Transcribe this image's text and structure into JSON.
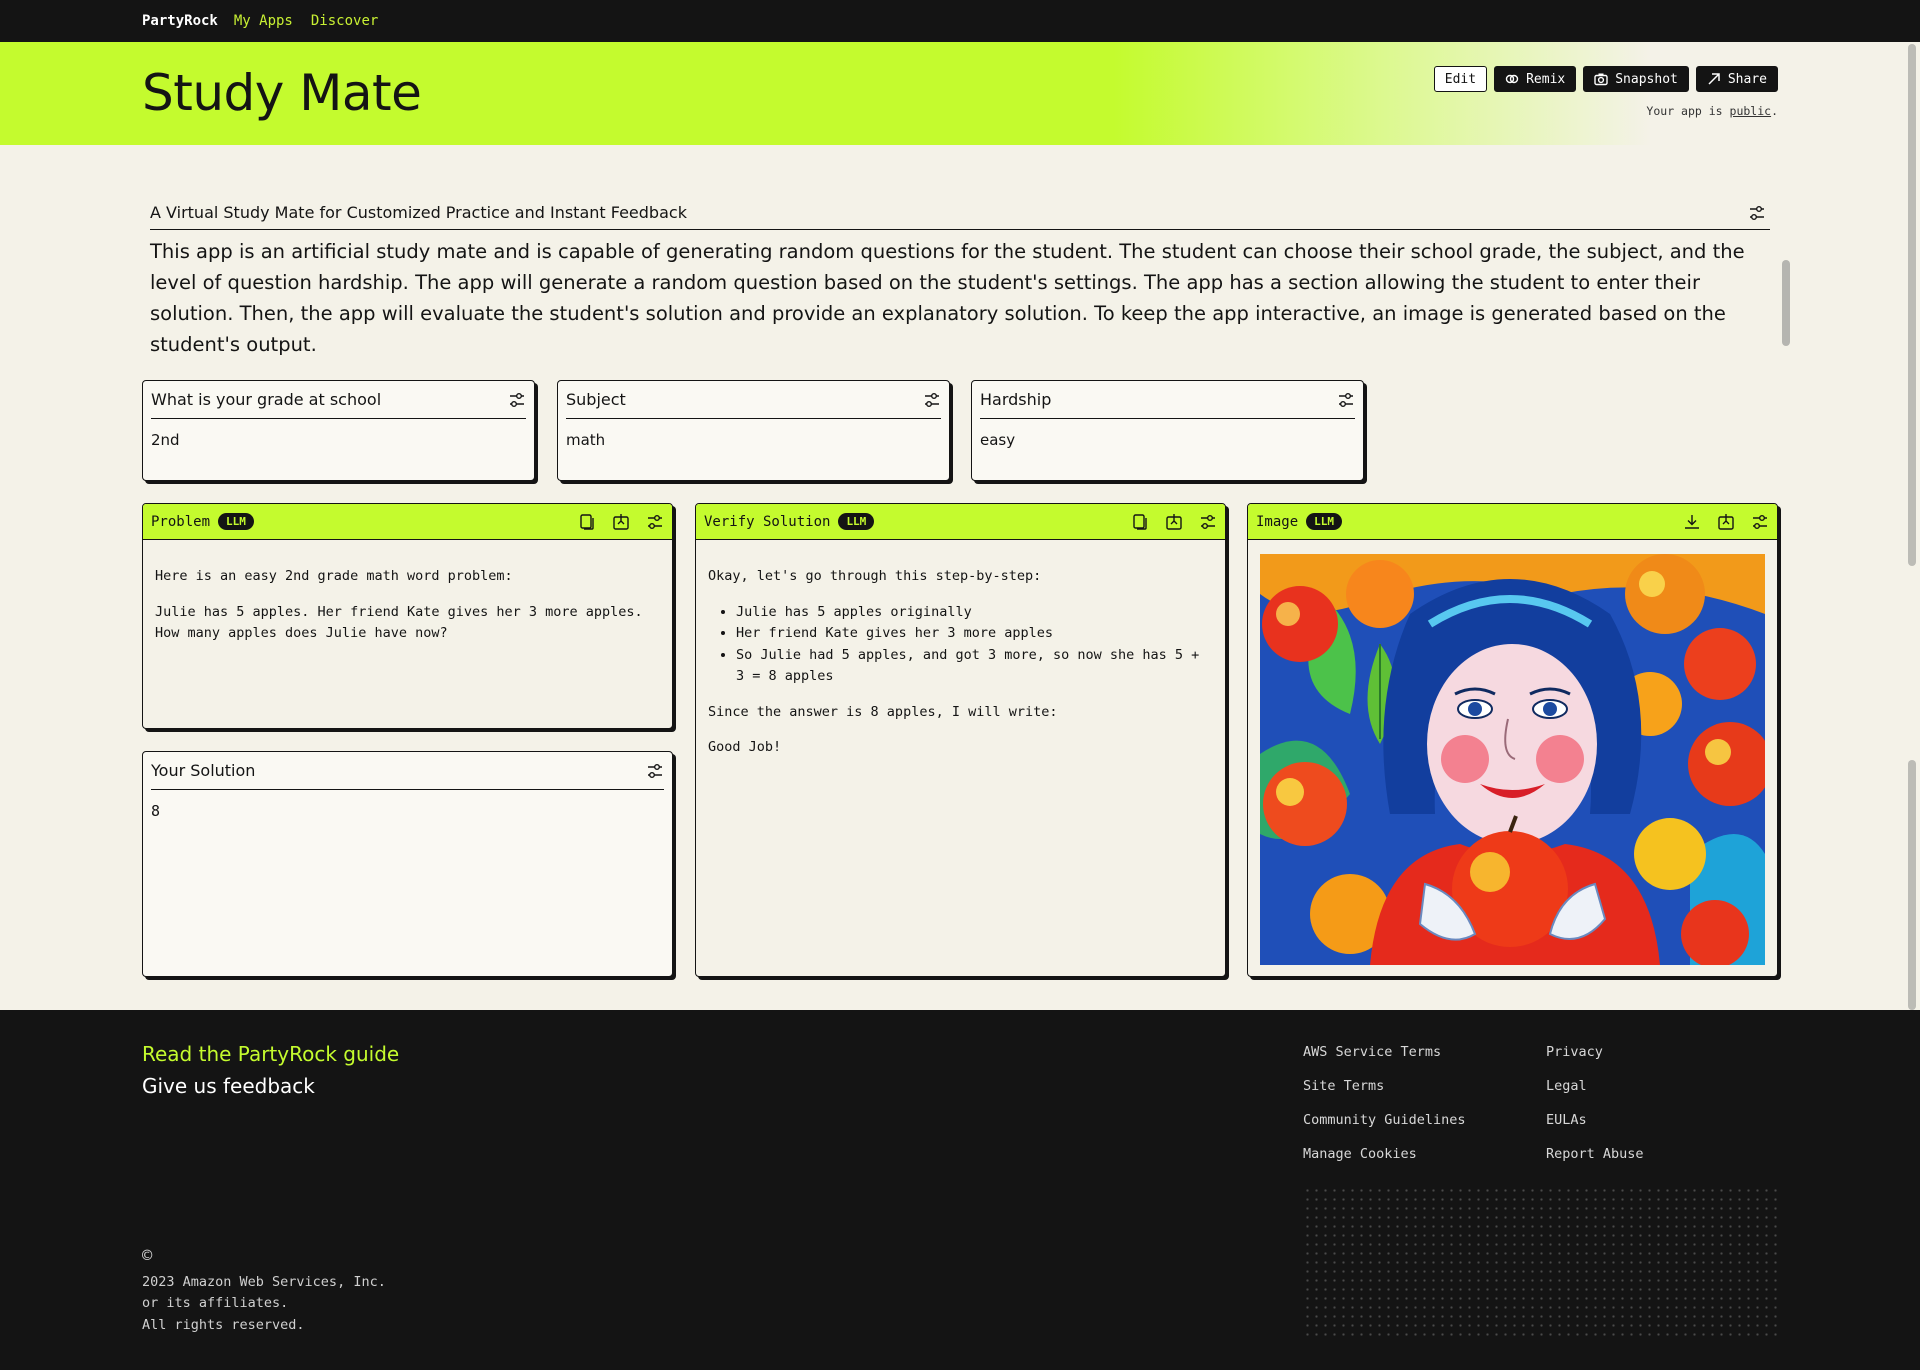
{
  "nav": {
    "brand": "PartyRock",
    "links": [
      "My Apps",
      "Discover"
    ]
  },
  "app": {
    "title": "Study Mate",
    "actions": {
      "edit": "Edit",
      "remix": "Remix",
      "snapshot": "Snapshot",
      "share": "Share"
    },
    "visibility_prefix": "Your app is ",
    "visibility_link": "public",
    "visibility_suffix": "."
  },
  "description": {
    "heading": "A Virtual Study Mate for Customized Practice and Instant Feedback",
    "body": "This app is an artificial study mate and is capable of generating random questions for the student. The student can choose their school grade, the subject, and the level of question hardship. The app will generate a random question based on the student's settings. The app has a section allowing the student to enter their solution. Then, the app will evaluate the student's solution and provide an explanatory solution. To keep the app interactive, an image is generated based on the student's output."
  },
  "inputs": [
    {
      "label": "What is your grade at school",
      "value": "2nd"
    },
    {
      "label": "Subject",
      "value": "math"
    },
    {
      "label": "Hardship",
      "value": "easy"
    }
  ],
  "problem": {
    "title": "Problem",
    "badge": "LLM",
    "paragraphs": [
      "Here is an easy 2nd grade math word problem:",
      "Julie has 5 apples. Her friend Kate gives her 3 more apples. How many apples does Julie have now?"
    ]
  },
  "solution_input": {
    "label": "Your Solution",
    "value": "8"
  },
  "verify": {
    "title": "Verify Solution",
    "badge": "LLM",
    "intro": "Okay, let's go through this step-by-step:",
    "bullets": [
      "Julie has 5 apples originally",
      "Her friend Kate gives her 3 more apples",
      "So Julie had 5 apples, and got 3 more, so now she has 5 + 3 = 8 apples"
    ],
    "conclusion": "Since the answer is 8 apples, I will write:",
    "verdict": "Good Job!"
  },
  "image_widget": {
    "title": "Image",
    "badge": "LLM"
  },
  "footer": {
    "guide": "Read the PartyRock guide",
    "feedback": "Give us feedback",
    "links": [
      "AWS Service Terms",
      "Privacy",
      "Site Terms",
      "Legal",
      "Community Guidelines",
      "EULAs",
      "Manage Cookies",
      "Report Abuse"
    ],
    "copyright_symbol": "©",
    "copyright_lines": [
      "2023 Amazon Web Services, Inc.",
      "or its affiliates.",
      "All rights reserved."
    ]
  },
  "colors": {
    "accent": "#c4fb2e",
    "dark": "#141414",
    "background": "#f4f2e8"
  }
}
